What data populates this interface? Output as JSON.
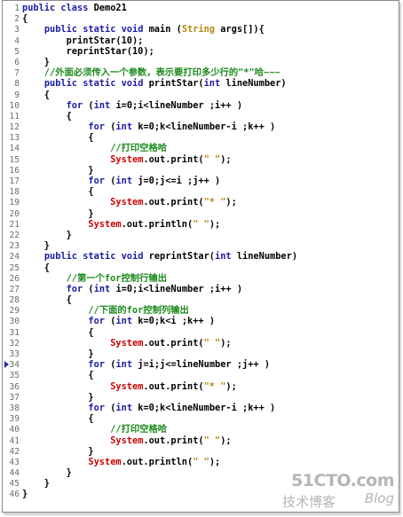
{
  "lines": [
    {
      "n": "1",
      "t": [
        [
          "kw",
          "public class "
        ],
        [
          "pl",
          "Demo21"
        ]
      ]
    },
    {
      "n": "2",
      "t": [
        [
          "pl",
          "{"
        ]
      ]
    },
    {
      "n": "3",
      "t": [
        [
          "pl",
          "    "
        ],
        [
          "kw",
          "public static void "
        ],
        [
          "pl",
          "main ("
        ],
        [
          "str",
          "String "
        ],
        [
          "pl",
          "args[]){"
        ]
      ]
    },
    {
      "n": "4",
      "t": [
        [
          "pl",
          "        printStar(10);"
        ]
      ]
    },
    {
      "n": "5",
      "t": [
        [
          "pl",
          "        reprintStar(10);"
        ]
      ]
    },
    {
      "n": "6",
      "t": [
        [
          "pl",
          "    }"
        ]
      ]
    },
    {
      "n": "7",
      "t": [
        [
          "cm",
          "    //外面必须传入一个参数，表示要打印多少行的\"*\"哈~~~"
        ]
      ]
    },
    {
      "n": "8",
      "t": [
        [
          "pl",
          "    "
        ],
        [
          "kw",
          "public static void "
        ],
        [
          "pl",
          "printStar("
        ],
        [
          "kw",
          "int "
        ],
        [
          "pl",
          "lineNumber)"
        ]
      ]
    },
    {
      "n": "9",
      "t": [
        [
          "pl",
          "    {"
        ]
      ]
    },
    {
      "n": "10",
      "t": [
        [
          "pl",
          "        "
        ],
        [
          "kw",
          "for "
        ],
        [
          "pl",
          "("
        ],
        [
          "kw",
          "int "
        ],
        [
          "pl",
          "i=0;i<lineNumber ;i++ )"
        ]
      ]
    },
    {
      "n": "11",
      "t": [
        [
          "pl",
          "        {"
        ]
      ]
    },
    {
      "n": "12",
      "t": [
        [
          "pl",
          "            "
        ],
        [
          "kw",
          "for "
        ],
        [
          "pl",
          "("
        ],
        [
          "kw",
          "int "
        ],
        [
          "pl",
          "k=0;k<lineNumber-i ;k++ )"
        ]
      ]
    },
    {
      "n": "13",
      "t": [
        [
          "pl",
          "            {"
        ]
      ]
    },
    {
      "n": "14",
      "t": [
        [
          "cm",
          "                //打印空格哈"
        ]
      ]
    },
    {
      "n": "15",
      "t": [
        [
          "pl",
          "                "
        ],
        [
          "sys",
          "System"
        ],
        [
          "pl",
          ".out.print("
        ],
        [
          "str",
          "\" \""
        ],
        [
          "pl",
          ");"
        ]
      ]
    },
    {
      "n": "16",
      "t": [
        [
          "pl",
          "            }"
        ]
      ]
    },
    {
      "n": "17",
      "t": [
        [
          "pl",
          "            "
        ],
        [
          "kw",
          "for "
        ],
        [
          "pl",
          "("
        ],
        [
          "kw",
          "int "
        ],
        [
          "pl",
          "j=0;j<=i ;j++ )"
        ]
      ]
    },
    {
      "n": "18",
      "t": [
        [
          "pl",
          "            {"
        ]
      ]
    },
    {
      "n": "19",
      "t": [
        [
          "pl",
          "                "
        ],
        [
          "sys",
          "System"
        ],
        [
          "pl",
          ".out.print("
        ],
        [
          "str",
          "\"* \""
        ],
        [
          "pl",
          ");"
        ]
      ]
    },
    {
      "n": "20",
      "t": [
        [
          "pl",
          "            }"
        ]
      ]
    },
    {
      "n": "21",
      "t": [
        [
          "pl",
          "            "
        ],
        [
          "sys",
          "System"
        ],
        [
          "pl",
          ".out.println("
        ],
        [
          "str",
          "\" \""
        ],
        [
          "pl",
          ");"
        ]
      ]
    },
    {
      "n": "22",
      "t": [
        [
          "pl",
          "        }"
        ]
      ]
    },
    {
      "n": "23",
      "t": [
        [
          "pl",
          "    }"
        ]
      ]
    },
    {
      "n": "24",
      "t": [
        [
          "pl",
          "    "
        ],
        [
          "kw",
          "public static void "
        ],
        [
          "pl",
          "reprintStar("
        ],
        [
          "kw",
          "int "
        ],
        [
          "pl",
          "lineNumber)"
        ]
      ]
    },
    {
      "n": "25",
      "t": [
        [
          "pl",
          "    {"
        ]
      ]
    },
    {
      "n": "26",
      "t": [
        [
          "cm",
          "        //第一个for控制行输出"
        ]
      ]
    },
    {
      "n": "27",
      "t": [
        [
          "pl",
          "        "
        ],
        [
          "kw",
          "for "
        ],
        [
          "pl",
          "("
        ],
        [
          "kw",
          "int "
        ],
        [
          "pl",
          "i=0;i<lineNumber ;i++ )"
        ]
      ]
    },
    {
      "n": "28",
      "t": [
        [
          "pl",
          "        {"
        ]
      ]
    },
    {
      "n": "29",
      "t": [
        [
          "cm",
          "            //下面的for控制列输出"
        ]
      ]
    },
    {
      "n": "30",
      "t": [
        [
          "pl",
          "            "
        ],
        [
          "kw",
          "for "
        ],
        [
          "pl",
          "("
        ],
        [
          "kw",
          "int "
        ],
        [
          "pl",
          "k=0;k<i ;k++ )"
        ]
      ]
    },
    {
      "n": "31",
      "t": [
        [
          "pl",
          "            {"
        ]
      ]
    },
    {
      "n": "32",
      "t": [
        [
          "pl",
          "                "
        ],
        [
          "sys",
          "System"
        ],
        [
          "pl",
          ".out.print("
        ],
        [
          "str",
          "\" \""
        ],
        [
          "pl",
          ");"
        ]
      ]
    },
    {
      "n": "33",
      "t": [
        [
          "pl",
          "            }"
        ]
      ]
    },
    {
      "n": "34",
      "t": [
        [
          "pl",
          "            "
        ],
        [
          "kw",
          "for "
        ],
        [
          "pl",
          "("
        ],
        [
          "kw",
          "int "
        ],
        [
          "pl",
          "j=i;j<=lineNumber ;j++ )"
        ]
      ],
      "marker": true
    },
    {
      "n": "35",
      "t": [
        [
          "pl",
          "            {"
        ]
      ]
    },
    {
      "n": "36",
      "t": [
        [
          "pl",
          "                "
        ],
        [
          "sys",
          "System"
        ],
        [
          "pl",
          ".out.print("
        ],
        [
          "str",
          "\"* \""
        ],
        [
          "pl",
          ");"
        ]
      ]
    },
    {
      "n": "37",
      "t": [
        [
          "pl",
          "            }"
        ]
      ]
    },
    {
      "n": "38",
      "t": [
        [
          "pl",
          "            "
        ],
        [
          "kw",
          "for "
        ],
        [
          "pl",
          "("
        ],
        [
          "kw",
          "int "
        ],
        [
          "pl",
          "k=0;k<lineNumber-i ;k++ )"
        ]
      ]
    },
    {
      "n": "39",
      "t": [
        [
          "pl",
          "            {"
        ]
      ]
    },
    {
      "n": "40",
      "t": [
        [
          "cm",
          "                //打印空格哈"
        ]
      ]
    },
    {
      "n": "41",
      "t": [
        [
          "pl",
          "                "
        ],
        [
          "sys",
          "System"
        ],
        [
          "pl",
          ".out.print("
        ],
        [
          "str",
          "\" \""
        ],
        [
          "pl",
          ");"
        ]
      ]
    },
    {
      "n": "42",
      "t": [
        [
          "pl",
          "            }"
        ]
      ]
    },
    {
      "n": "43",
      "t": [
        [
          "pl",
          "            "
        ],
        [
          "sys",
          "System"
        ],
        [
          "pl",
          ".out.println("
        ],
        [
          "str",
          "\" \""
        ],
        [
          "pl",
          ");"
        ]
      ]
    },
    {
      "n": "44",
      "t": [
        [
          "pl",
          "        }"
        ]
      ]
    },
    {
      "n": "45",
      "t": [
        [
          "pl",
          "    }"
        ]
      ]
    },
    {
      "n": "46",
      "t": [
        [
          "pl",
          "}"
        ]
      ]
    }
  ],
  "watermark": {
    "site": "51CTO.com",
    "sub": "技术博客",
    "blog": "Blog"
  },
  "colors": {
    "keyword": "#1a1aa6",
    "string": "#b8860b",
    "comment": "#1c8a1c",
    "system": "#cc0000",
    "plain": "#000000",
    "line_number": "#6b6b6b"
  }
}
